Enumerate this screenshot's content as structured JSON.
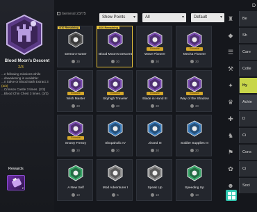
{
  "left": {
    "title": "Blood Moon's Descent",
    "progress": "2/3",
    "desc_lines": [
      {
        "text": "...e following missions while",
        "hl": false
      },
      {
        "text": "...dawakening is available:",
        "hl": false
      },
      {
        "text": "...n Salve or Blood Bath Extract 3",
        "hl": false
      },
      {
        "text": "(3/3)",
        "hl": true
      },
      {
        "text": "...Crimson Castle 3 times. (2/3)",
        "hl": false
      },
      {
        "text": "...Blood Chin Chest 3 times. (3/3)",
        "hl": false
      }
    ],
    "rewards_label": "Rewards",
    "reward_qty": "2"
  },
  "topbar": {
    "general": "General 23/75",
    "filter_points": "Show Points",
    "filter_all": "All",
    "filter_sort": "Default",
    "corner": "D"
  },
  "cards": [
    {
      "name": "Demon Hunter",
      "pts": "30",
      "remain": "4/10 Remaining",
      "tag": "",
      "color": "#5a5a5a",
      "sel": false
    },
    {
      "name": "Blood Moon's Descent",
      "pts": "30",
      "remain": "4/10 Remaining",
      "tag": "",
      "color": "#7a4bb0",
      "sel": true
    },
    {
      "name": "Wave Pioneer",
      "pts": "30",
      "remain": "",
      "tag": "Exclusive",
      "color": "#7a4bb0",
      "sel": false
    },
    {
      "name": "Mecha Pioneer",
      "pts": "30",
      "remain": "",
      "tag": "Exclusive",
      "color": "#7a4bb0",
      "sel": false
    },
    {
      "name": "Wish Master",
      "pts": "30",
      "remain": "",
      "tag": "Exclusive",
      "color": "#7a4bb0",
      "sel": false
    },
    {
      "name": "Skyhigh Traveler",
      "pts": "30",
      "remain": "",
      "tag": "Exclusive",
      "color": "#7a4bb0",
      "sel": false
    },
    {
      "name": "Blade in Hand III",
      "pts": "30",
      "remain": "",
      "tag": "Exclusive",
      "color": "#7a4bb0",
      "sel": false
    },
    {
      "name": "Way of the Shadow",
      "pts": "30",
      "remain": "",
      "tag": "Exclusive",
      "color": "#7a4bb0",
      "sel": false
    },
    {
      "name": "Snowy Frenzy",
      "pts": "30",
      "remain": "",
      "tag": "Exclusive",
      "color": "#7a4bb0",
      "sel": false
    },
    {
      "name": "Shopaholic IV",
      "pts": "30",
      "remain": "",
      "tag": "",
      "color": "#3a7ab8",
      "sel": false
    },
    {
      "name": "Jinxed III",
      "pts": "30",
      "remain": "",
      "tag": "",
      "color": "#3a7ab8",
      "sel": false
    },
    {
      "name": "Soldier Supplies III",
      "pts": "30",
      "remain": "",
      "tag": "",
      "color": "#3a7ab8",
      "sel": false
    },
    {
      "name": "A New Self",
      "pts": "10",
      "remain": "",
      "tag": "",
      "color": "#3aa86a",
      "sel": false
    },
    {
      "name": "Mod Adventurer I",
      "pts": "5",
      "remain": "",
      "tag": "",
      "color": "#8a8a8a",
      "sel": false
    },
    {
      "name": "Speak Up",
      "pts": "10",
      "remain": "",
      "tag": "",
      "color": "#8a8a8a",
      "sel": false
    },
    {
      "name": "Speeding Up",
      "pts": "10",
      "remain": "",
      "tag": "",
      "color": "#3aa86a",
      "sel": false
    }
  ],
  "menu": [
    {
      "label": "Be"
    },
    {
      "label": "Sh"
    },
    {
      "label": "Care"
    },
    {
      "label": "Colle"
    },
    {
      "label": "Hy"
    },
    {
      "label": "Achie"
    },
    {
      "label": "D"
    },
    {
      "label": "Ci"
    },
    {
      "label": "Cons"
    },
    {
      "label": "Ci"
    },
    {
      "label": "Soci"
    }
  ]
}
